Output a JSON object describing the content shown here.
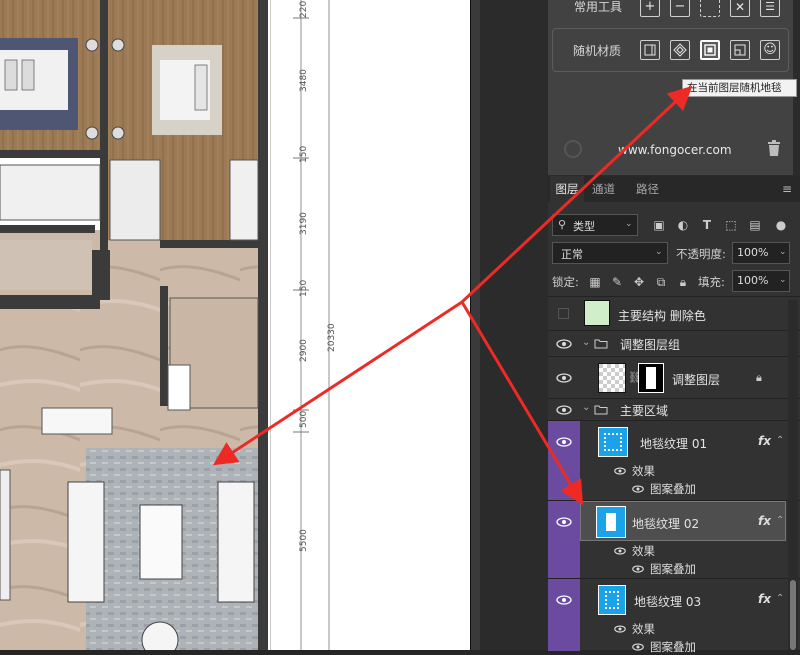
{
  "canvas": {
    "dimensions": [
      "220",
      "3480",
      "150",
      "3190",
      "150",
      "2900",
      "500",
      "5500"
    ],
    "total": "20330"
  },
  "plugin": {
    "common_tools_label": "常用工具",
    "random_material_label": "随机材质",
    "tooltip": "在当前图层随机地毯",
    "website": "www.fongocer.com"
  },
  "layers_panel": {
    "tabs": [
      {
        "label": "图层",
        "active": true
      },
      {
        "label": "通道",
        "active": false
      },
      {
        "label": "路径",
        "active": false
      }
    ],
    "filter_type": "类型",
    "blend_mode": "正常",
    "opacity_label": "不透明度:",
    "opacity_value": "100%",
    "lock_label": "锁定:",
    "fill_label": "填充:",
    "fill_value": "100%",
    "layers": [
      {
        "name": "主要结构 删除色"
      },
      {
        "name": "调整图层组"
      },
      {
        "name": "调整图层"
      },
      {
        "name": "主要区域"
      },
      {
        "name": "地毯纹理 01",
        "fx": "fx",
        "effects_label": "效果",
        "effect": "图案叠加"
      },
      {
        "name": "地毯纹理 02",
        "fx": "fx",
        "effects_label": "效果",
        "effect": "图案叠加"
      },
      {
        "name": "地毯纹理 03",
        "fx": "fx",
        "effects_label": "效果",
        "effect": "图案叠加"
      }
    ]
  },
  "colors": {
    "accent_purple": "#6a4ba0",
    "arrow_red": "#ee2a24",
    "thumb_blue": "#1aa3e8"
  },
  "icons": [
    "plus-icon",
    "minus-icon",
    "dashed-square-icon",
    "x-square-icon",
    "list-icon",
    "frame-icon",
    "diamond-pattern-icon",
    "rug-icon",
    "corner-icon",
    "smile-icon",
    "trash-icon",
    "eye-icon",
    "folder-icon",
    "link-icon",
    "lock-icon",
    "menu-icon",
    "search-icon"
  ]
}
